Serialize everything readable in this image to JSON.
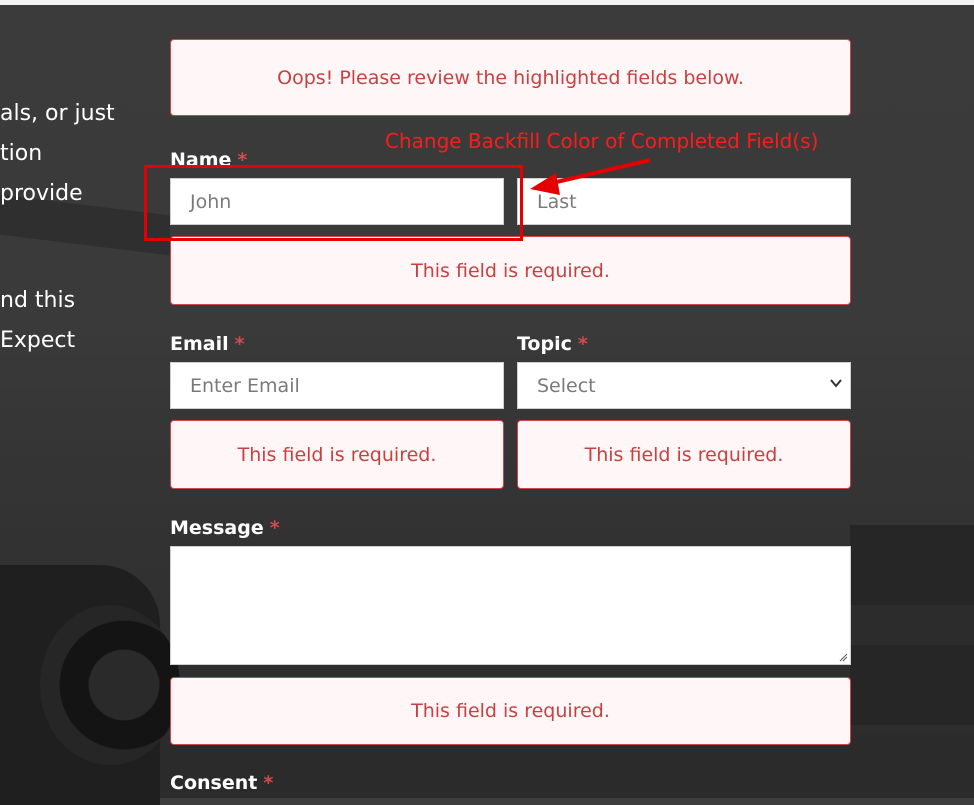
{
  "sidebar_fragments": [
    {
      "text": "als, or just"
    },
    {
      "text": "tion"
    },
    {
      "text": "provide"
    },
    {
      "text": "nd this"
    },
    {
      "text": "Expect"
    }
  ],
  "form": {
    "error_summary": "Oops! Please review the highlighted fields below.",
    "name_label": "Name",
    "first_placeholder": "John",
    "last_placeholder": "Last",
    "email_label": "Email",
    "email_placeholder": "Enter Email",
    "topic_label": "Topic",
    "topic_selected": "Select",
    "message_label": "Message",
    "consent_label": "Consent",
    "required_marker": "*",
    "required_error": "This field is required."
  },
  "annotation": {
    "text": "Change Backfill Color of Completed Field(s)",
    "color": "#e50000"
  },
  "colors": {
    "error_border": "#d64545",
    "error_text": "#c94040",
    "error_bg": "#fff7f7",
    "background": "#3d3d3d"
  }
}
